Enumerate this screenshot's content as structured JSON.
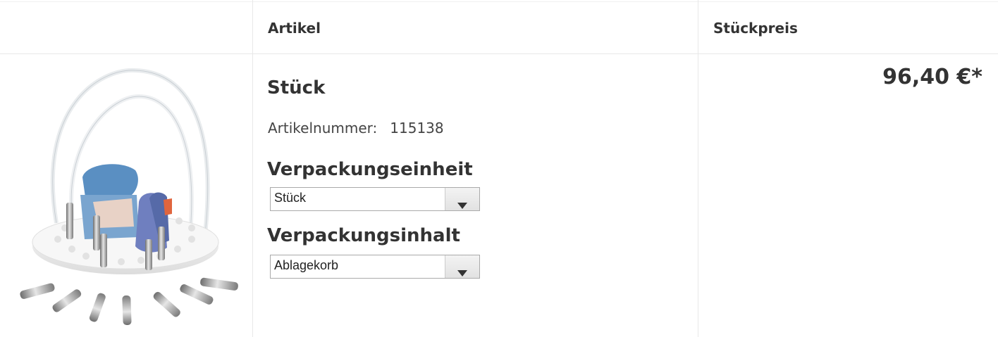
{
  "header": {
    "col_article": "Artikel",
    "col_unit_price": "Stückpreis"
  },
  "product": {
    "name": "Stück",
    "article_number_label": "Artikelnummer:",
    "article_number": "115138",
    "price": "96,40 €*",
    "image_icon": "product-photo-dental-model-holder"
  },
  "options": {
    "packaging_unit_label": "Verpackungseinheit",
    "packaging_unit_value": "Stück",
    "packaging_content_label": "Verpackungsinhalt",
    "packaging_content_value": "Ablagekorb"
  },
  "colors": {
    "text": "#333333",
    "border": "#e8e8e8",
    "select_border": "#aaaaaa"
  }
}
